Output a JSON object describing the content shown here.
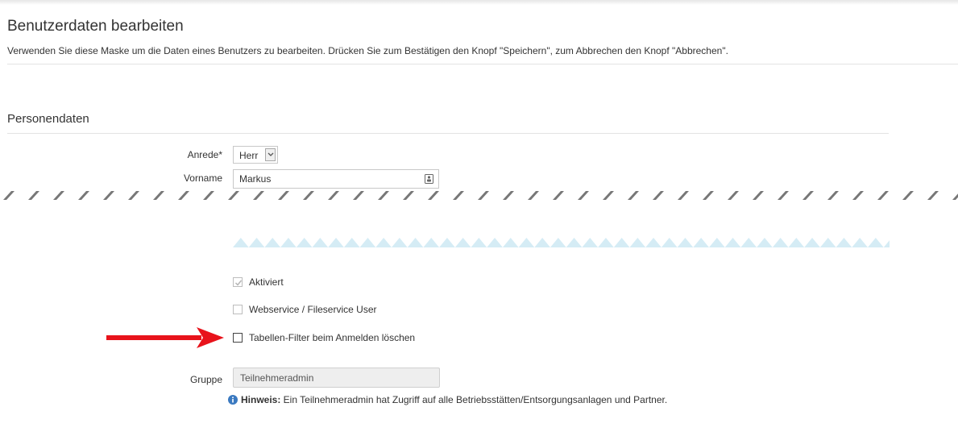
{
  "page": {
    "title": "Benutzerdaten bearbeiten",
    "description": "Verwenden Sie diese Maske um die Daten eines Benutzers zu bearbeiten. Drücken Sie zum Bestätigen den Knopf \"Speichern\", zum Abbrechen den Knopf \"Abbrechen\"."
  },
  "section": {
    "title": "Personendaten"
  },
  "fields": {
    "anrede": {
      "label": "Anrede*",
      "value": "Herr",
      "icon": "chevron-down-icon"
    },
    "vorname": {
      "label": "Vorname",
      "value": "Markus",
      "icon": "contact-card-icon"
    },
    "gruppe": {
      "label": "Gruppe",
      "value": "Teilnehmeradmin"
    }
  },
  "checkboxes": {
    "aktiviert": {
      "label": "Aktiviert",
      "checked": true,
      "disabled": true
    },
    "webservice": {
      "label": "Webservice / Fileservice User",
      "checked": false,
      "disabled": true
    },
    "tabellen_filter": {
      "label": "Tabellen-Filter beim Anmelden löschen",
      "checked": false,
      "disabled": false
    }
  },
  "hint": {
    "icon": "info-icon",
    "label": "Hinweis:",
    "text": " Ein Teilnehmeradmin hat Zugriff auf alle Betriebsstätten/Entsorgungsanlagen und Partner."
  },
  "annotation": {
    "icon": "red-arrow-icon",
    "color": "#e8131b"
  },
  "colors": {
    "info": "#3a79c0",
    "cut_edge_top": "#777777",
    "cut_edge_bottom": "#d5ecf5"
  }
}
